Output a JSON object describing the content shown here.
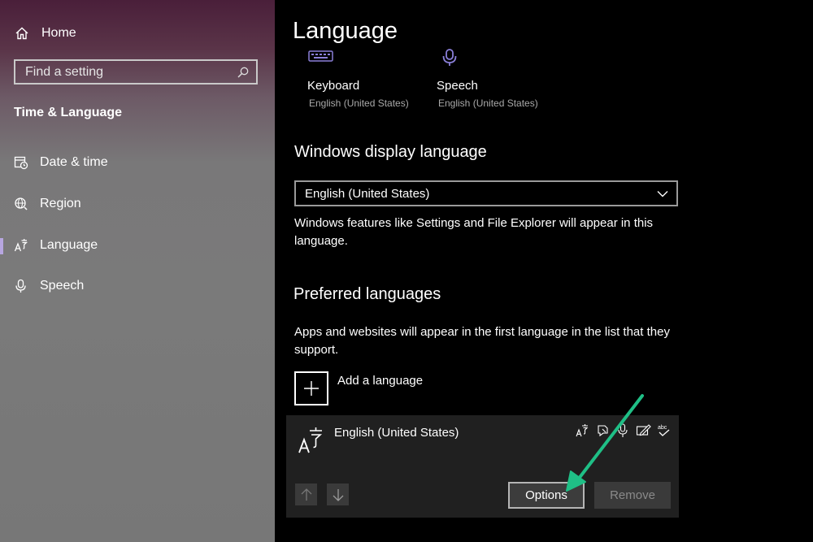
{
  "sidebar": {
    "home_label": "Home",
    "search_placeholder": "Find a setting",
    "section_title": "Time & Language",
    "items": [
      {
        "label": "Date & time",
        "icon": "calendar-clock-icon"
      },
      {
        "label": "Region",
        "icon": "globe-icon"
      },
      {
        "label": "Language",
        "icon": "language-icon",
        "selected": true
      },
      {
        "label": "Speech",
        "icon": "microphone-icon"
      }
    ],
    "accent_color": "#b7a6e0"
  },
  "main": {
    "title": "Language",
    "tiles": [
      {
        "name": "Keyboard",
        "sub": "English (United States)",
        "icon": "keyboard-icon"
      },
      {
        "name": "Speech",
        "sub": "English (United States)",
        "icon": "microphone-icon"
      }
    ],
    "display_language": {
      "heading": "Windows display language",
      "selected": "English (United States)",
      "description": "Windows features like Settings and File Explorer will appear in this language."
    },
    "preferred": {
      "heading": "Preferred languages",
      "description": "Apps and websites will appear in the first language in the list that they support.",
      "add_label": "Add a language",
      "language": {
        "name": "English (United States)",
        "feature_icons": [
          "display-language-icon",
          "text-to-speech-icon",
          "speech-recognition-icon",
          "handwriting-icon",
          "spellcheck-icon"
        ],
        "options_label": "Options",
        "remove_label": "Remove"
      }
    }
  },
  "annotation": {
    "arrow_color": "#1fbf86"
  }
}
